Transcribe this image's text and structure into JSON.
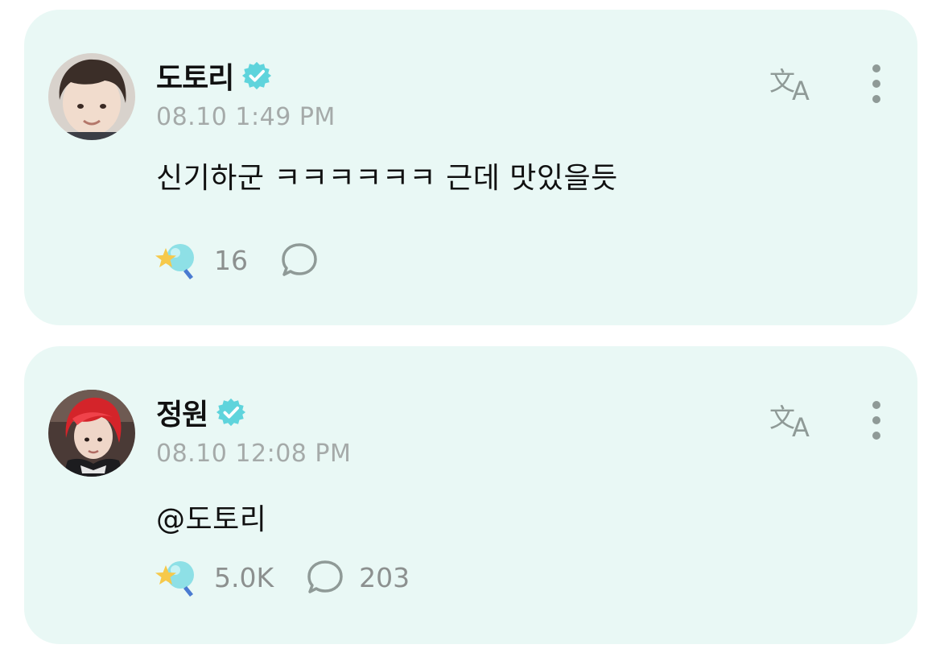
{
  "comments": [
    {
      "author": "도토리",
      "verified": true,
      "timestamp": "08.10 1:49 PM",
      "text": "신기하군 ㅋㅋㅋㅋㅋㅋ 근데 맛있을듯",
      "reaction_count": "16",
      "reply_count": ""
    },
    {
      "author": "정원",
      "verified": true,
      "timestamp": "08.10 12:08 PM",
      "text": "@도토리",
      "reaction_count": "5.0K",
      "reply_count": "203"
    }
  ],
  "icons": {
    "verified": "verified-badge-icon",
    "translate": "translate-icon",
    "more": "more-vertical-icon",
    "reaction": "star-lightstick-icon",
    "reply": "speech-bubble-icon"
  },
  "colors": {
    "card_background": "#e9f8f5",
    "accent": "#5fd4dc",
    "icon_gray": "#8f9a97",
    "meta_text": "#a5aaa9"
  }
}
